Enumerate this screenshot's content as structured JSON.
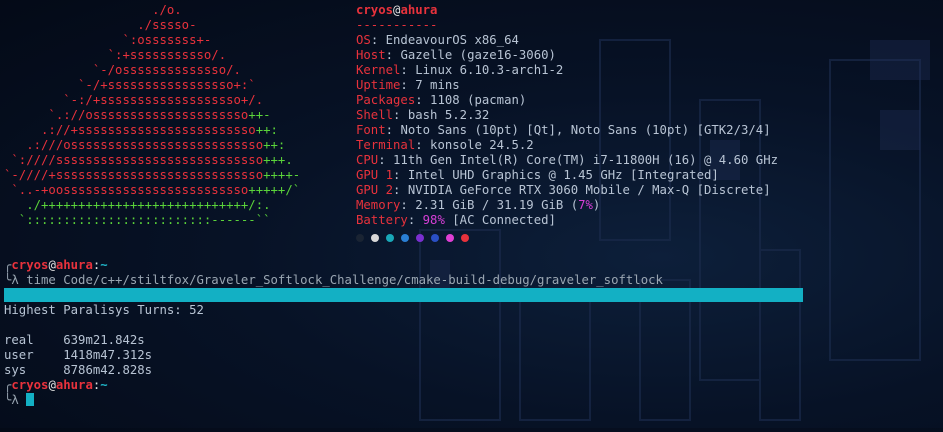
{
  "logo_lines": [
    {
      "red": "                    ./o.",
      "grn": ""
    },
    {
      "red": "                  ./sssso-",
      "grn": ""
    },
    {
      "red": "                `:osssssss+-",
      "grn": ""
    },
    {
      "red": "              `:+sssssssssso/.",
      "grn": ""
    },
    {
      "red": "            `-/ossssssssssssso/.",
      "grn": ""
    },
    {
      "red": "          `-/+sssssssssssssssso+:`",
      "grn": ""
    },
    {
      "red": "        `-:/+sssssssssssssssssso+/.",
      "grn": ""
    },
    {
      "red": "      `.://osssssssssssssssssssso",
      "grn": "++-"
    },
    {
      "red": "     .://+ssssssssssssssssssssssso",
      "grn": "++:"
    },
    {
      "red": "   .:///ossssssssssssssssssssssssso",
      "grn": "++:"
    },
    {
      "red": " `:////ssssssssssssssssssssssssssso",
      "grn": "+++."
    },
    {
      "red": "`-////+ssssssssssssssssssssssssssso",
      "grn": "++++-"
    },
    {
      "red": " `..-+oosssssssssssssssssssssssso",
      "grn": "+++++/`"
    },
    {
      "red": "",
      "grn": "   ./++++++++++++++++++++++++++++/:."
    },
    {
      "red": "",
      "grn": "  `:::::::::::::::::::::::::------``"
    }
  ],
  "sysinfo": {
    "user": "cryos",
    "at": "@",
    "host": "ahura",
    "separator": "-----------",
    "rows": [
      {
        "key": "OS",
        "val": "EndeavourOS x86_64"
      },
      {
        "key": "Host",
        "val": "Gazelle (gaze16-3060)"
      },
      {
        "key": "Kernel",
        "val": "Linux 6.10.3-arch1-2"
      },
      {
        "key": "Uptime",
        "val": "7 mins"
      },
      {
        "key": "Packages",
        "val": "1108 (pacman)"
      },
      {
        "key": "Shell",
        "val": "bash 5.2.32"
      },
      {
        "key": "Font",
        "val": "Noto Sans (10pt) [Qt], Noto Sans (10pt) [GTK2/3/4]"
      },
      {
        "key": "Terminal",
        "val": "konsole 24.5.2"
      },
      {
        "key": "CPU",
        "val": "11th Gen Intel(R) Core(TM) i7-11800H (16) @ 4.60 GHz"
      },
      {
        "key": "GPU 1",
        "val": "Intel UHD Graphics @ 1.45 GHz [Integrated]"
      },
      {
        "key": "GPU 2",
        "val": "NVIDIA GeForce RTX 3060 Mobile / Max-Q [Discrete]"
      },
      {
        "key": "Memory",
        "val": "2.31 GiB / 31.19 GiB (",
        "pct": "7%",
        "tail": ")"
      },
      {
        "key": "Battery",
        "val": "",
        "pct": "98%",
        "tail": " [AC Connected]"
      }
    ],
    "palette": [
      "#1a2433",
      "#d8d8d8",
      "#19a8b8",
      "#2a7fd4",
      "#7b2fd0",
      "#2a4fc4",
      "#e03fd4",
      "#e8323c"
    ]
  },
  "prompt1": {
    "corner": "╭",
    "user": "cryos",
    "at": "@",
    "host": "ahura",
    "colon": ":",
    "path": "~",
    "lambda": "╰λ",
    "command": " time Code/c++/stiltfox/Graveler_Softlock_Challenge/cmake-build-debug/graveler_softlock"
  },
  "output": {
    "highest": "Highest Paralisys Turns: 52",
    "real_label": "real",
    "real_val": "639m21.842s",
    "user_label": "user",
    "user_val": "1418m47.312s",
    "sys_label": "sys",
    "sys_val": "8786m42.828s"
  },
  "prompt2": {
    "corner": "╭",
    "user": "cryos",
    "at": "@",
    "host": "ahura",
    "colon": ":",
    "path": "~",
    "lambda": "╰λ "
  }
}
